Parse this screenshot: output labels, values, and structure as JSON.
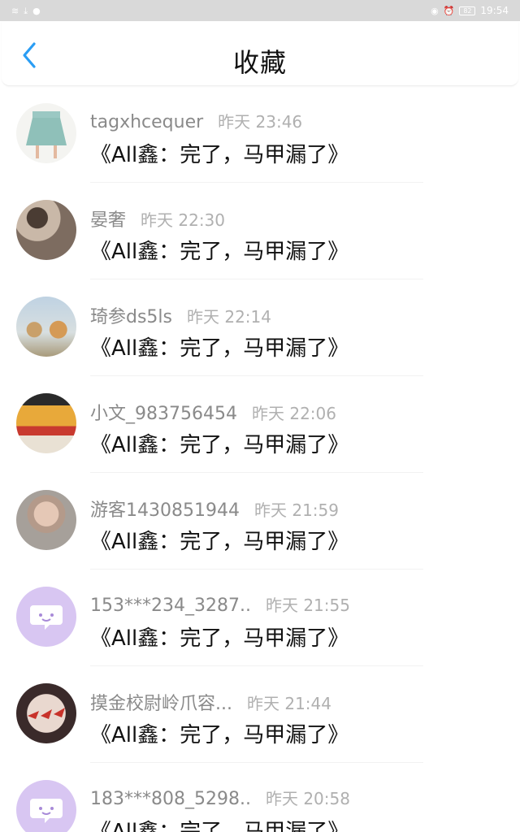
{
  "status_bar": {
    "left_icons": [
      "wifi-icon",
      "download-icon",
      "notification-icon"
    ],
    "battery": "82",
    "time": "19:54"
  },
  "header": {
    "title": "收藏",
    "back_icon": "chevron-left-icon",
    "accent_color": "#2a9df4"
  },
  "items": [
    {
      "username": "tagxhcequer",
      "time": "昨天 23:46",
      "message": "《All鑫：完了，马甲漏了》",
      "avatar": "skirt"
    },
    {
      "username": "晏奢",
      "time": "昨天 22:30",
      "message": "《All鑫：完了，马甲漏了》",
      "avatar": "girl"
    },
    {
      "username": "琦参ds5ls",
      "time": "昨天 22:14",
      "message": "《All鑫：完了，马甲漏了》",
      "avatar": "kids"
    },
    {
      "username": "小文_983756454",
      "time": "昨天 22:06",
      "message": "《All鑫：完了，马甲漏了》",
      "avatar": "group"
    },
    {
      "username": "游客1430851944",
      "time": "昨天 21:59",
      "message": "《All鑫：完了，马甲漏了》",
      "avatar": "boy"
    },
    {
      "username": "153***234_3287..",
      "time": "昨天 21:55",
      "message": "《All鑫：完了，马甲漏了》",
      "avatar": "purple"
    },
    {
      "username": "摸金校尉岭爪容...",
      "time": "昨天 21:44",
      "message": "《All鑫：完了，马甲漏了》",
      "avatar": "birds"
    },
    {
      "username": "183***808_5298..",
      "time": "昨天 20:58",
      "message": "《All鑫：完了，马甲漏了》",
      "avatar": "purple"
    }
  ]
}
